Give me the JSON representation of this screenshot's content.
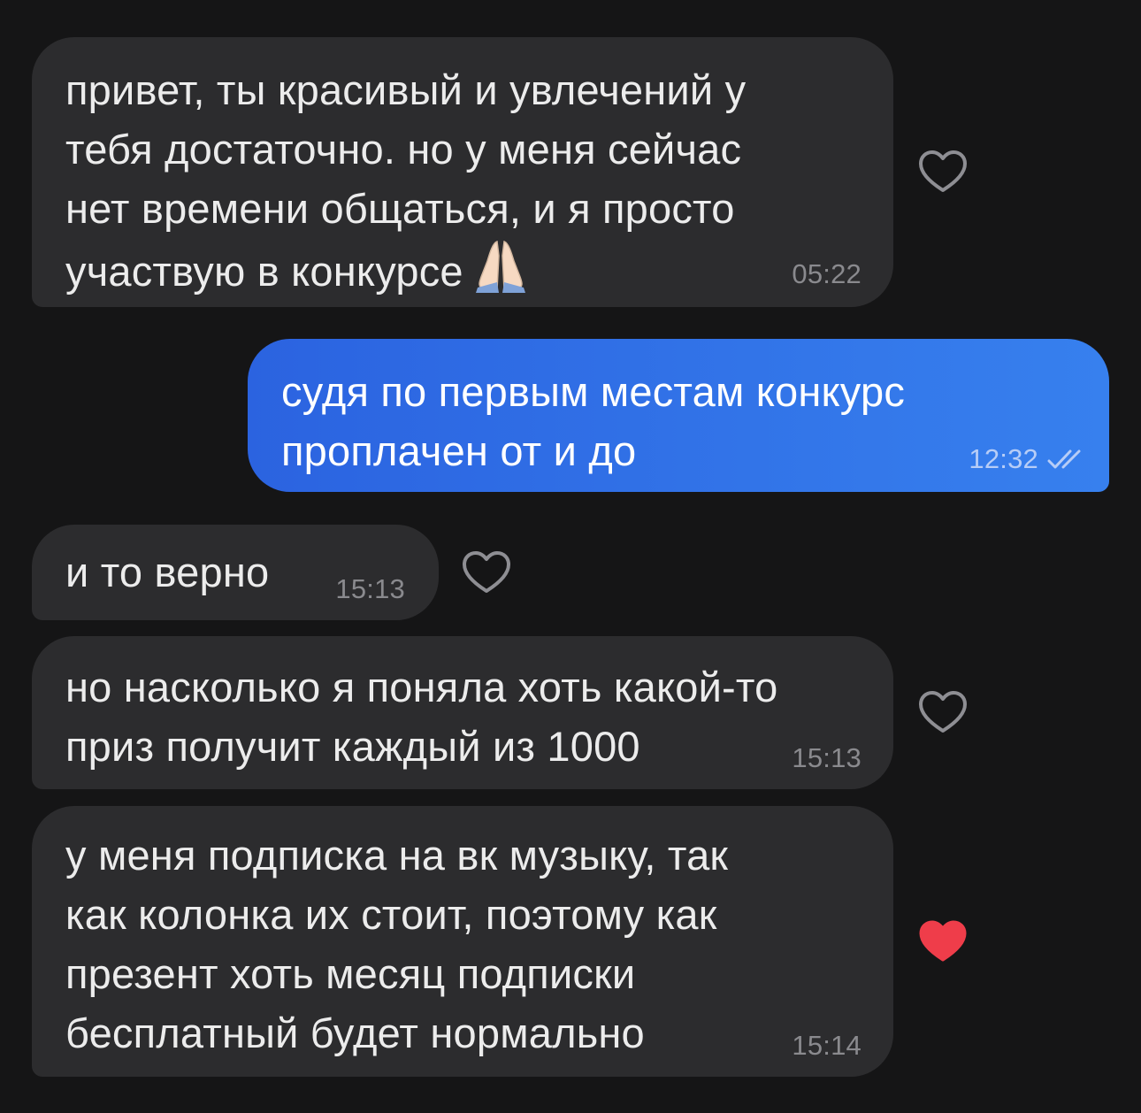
{
  "messages": [
    {
      "text": "привет, ты красивый и увлечений у\nтебя достаточно. но у меня сейчас\nнет времени общаться, и я просто\nучаствую в конкурсе",
      "emoji": "folded-hands",
      "time": "05:22",
      "liked": false
    },
    {
      "text": "судя по первым местам конкурс\nпроплачен от и до",
      "time": "12:32",
      "status": "read"
    },
    {
      "text": "и то верно",
      "time": "15:13",
      "liked": false
    },
    {
      "text": "но насколько я поняла хоть какой-то\nприз получит каждый из 1000",
      "time": "15:13",
      "liked": false
    },
    {
      "text": "у меня подписка на вк музыку, так\nкак колонка их стоит, поэтому как\nпрезент хоть месяц подписки\nбесплатный будет нормально",
      "time": "15:14",
      "liked": true
    }
  ],
  "colors": {
    "background": "#151516",
    "incoming_bubble": "#2c2c2e",
    "outgoing_bubble_start": "#2b63e0",
    "outgoing_bubble_end": "#3780ee",
    "heart_outline": "#8e8e93",
    "heart_liked": "#ef3d4a"
  }
}
